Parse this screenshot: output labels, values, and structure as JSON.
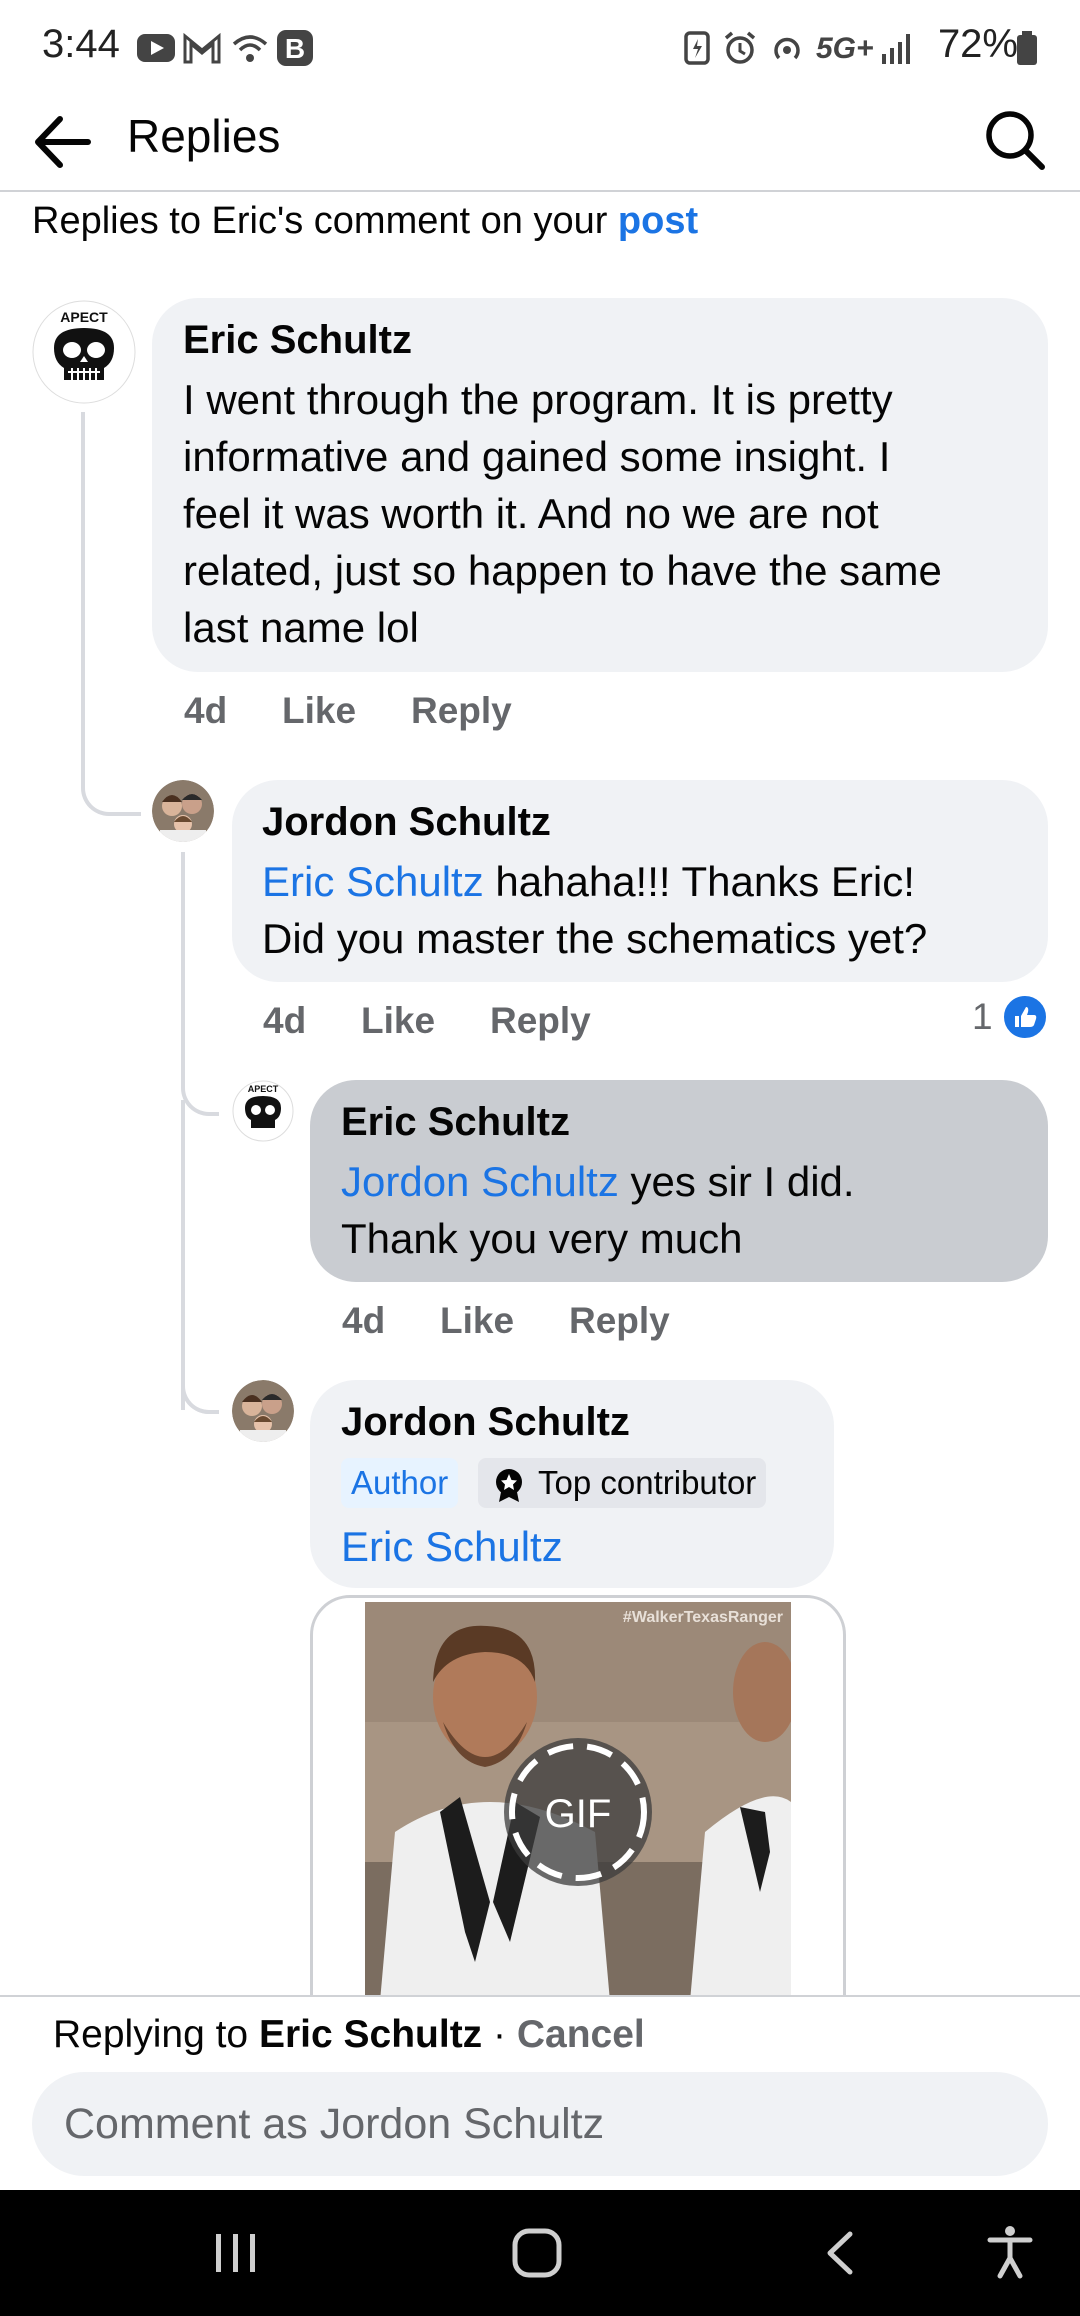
{
  "status_bar": {
    "time": "3:44",
    "network": "5G+",
    "battery": "72%"
  },
  "header": {
    "title": "Replies",
    "back_icon": "arrow-left-icon",
    "search_icon": "search-icon"
  },
  "context": {
    "prefix": "Replies to Eric's comment on your ",
    "link": "post"
  },
  "comments": [
    {
      "author": "Eric Schultz",
      "text_lines": [
        "I went through the program. It is pretty",
        "informative and gained some insight. I",
        "feel it was worth it. And no we are not",
        "related, just so happen to have the same",
        "last name lol"
      ],
      "time": "4d",
      "like": "Like",
      "reply": "Reply"
    },
    {
      "author": "Jordon Schultz",
      "mention": "Eric Schultz",
      "text_after_mention": " hahaha!!! Thanks Eric!",
      "text_line2": "Did you master the schematics yet?",
      "time": "4d",
      "like": "Like",
      "reply": "Reply",
      "reaction_count": "1"
    },
    {
      "author": "Eric Schultz",
      "mention": "Jordon Schultz",
      "text_after_mention": " yes sir I did.",
      "text_line2": "Thank you very much",
      "time": "4d",
      "like": "Like",
      "reply": "Reply"
    },
    {
      "author": "Jordon Schultz",
      "badge_author": "Author",
      "badge_top": "Top contributor",
      "mention": "Eric Schultz",
      "gif_watermark": "#WalkerTexasRanger",
      "gif_label": "GIF"
    }
  ],
  "reply_bar": {
    "replying_prefix": "Replying to ",
    "replying_name": "Eric Schultz",
    "separator": " · ",
    "cancel": "Cancel",
    "placeholder": "Comment as Jordon Schultz"
  },
  "colors": {
    "link": "#1b74e4",
    "bubble": "#f0f2f5",
    "bubble_selected": "#c9ccd1",
    "like_reaction": "#1b74e4"
  }
}
